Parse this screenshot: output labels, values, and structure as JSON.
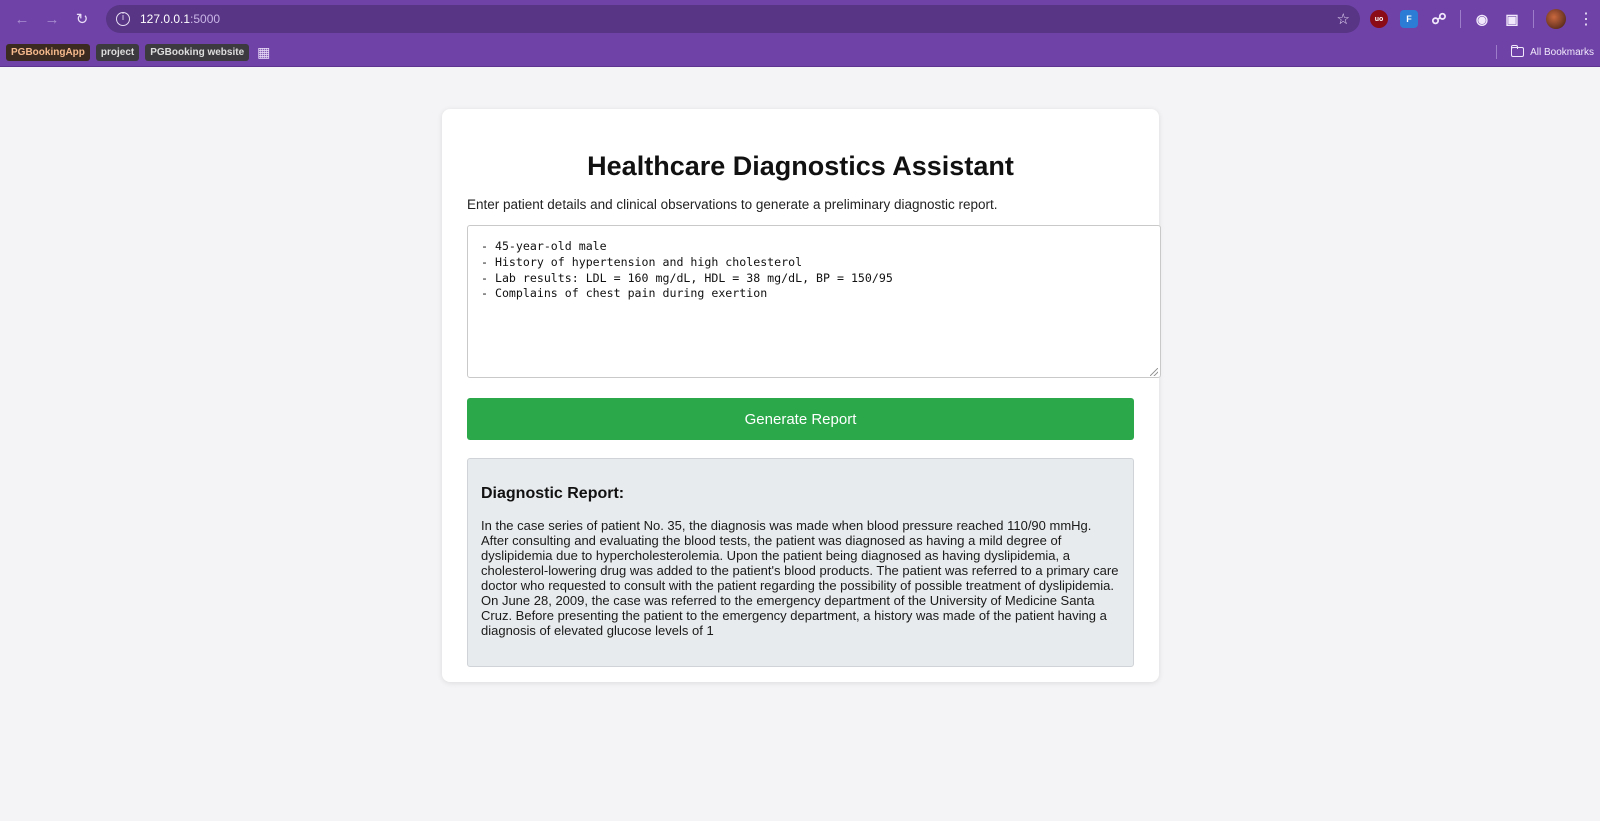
{
  "browser": {
    "url_host": "127.0.0.1",
    "url_port": ":5000",
    "bookmarks": [
      "PGBookingApp",
      "project",
      "PGBooking website"
    ],
    "all_bookmarks_label": "All Bookmarks",
    "ublock_badge": "uo",
    "gh_badge": "F"
  },
  "page": {
    "title": "Healthcare Diagnostics Assistant",
    "subtitle": "Enter patient details and clinical observations to generate a preliminary diagnostic report.",
    "notes_value": "- 45-year-old male\n- History of hypertension and high cholesterol\n- Lab results: LDL = 160 mg/dL, HDL = 38 mg/dL, BP = 150/95\n- Complains of chest pain during exertion",
    "generate_button_label": "Generate Report",
    "report": {
      "heading": "Diagnostic Report:",
      "body": "In the case series of patient No. 35, the diagnosis was made when blood pressure reached 110/90 mmHg. After consulting and evaluating the blood tests, the patient was diagnosed as having a mild degree of dyslipidemia due to hypercholesterolemia. Upon the patient being diagnosed as having dyslipidemia, a cholesterol-lowering drug was added to the patient's blood products. The patient was referred to a primary care doctor who requested to consult with the patient regarding the possibility of possible treatment of dyslipidemia. On June 28, 2009, the case was referred to the emergency department of the University of Medicine Santa Cruz. Before presenting the patient to the emergency department, a history was made of the patient having a diagnosis of elevated glucose levels of 1"
    }
  },
  "colors": {
    "chrome": "#6f42a8",
    "omnibox": "#583585",
    "button": "#2aa84a",
    "report_bg": "#e8ebed",
    "page_bg": "#f4f4f6"
  }
}
